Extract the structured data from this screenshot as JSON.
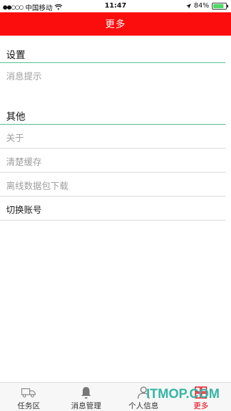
{
  "status_bar": {
    "carrier": "中国移动",
    "time": "11:47",
    "battery": "84%",
    "battery_level": 0.84,
    "signal_icon": "signal-dots-icon",
    "wifi_icon": "wifi-icon",
    "location_icon": "location-arrow-icon"
  },
  "nav": {
    "title": "更多",
    "color": "#fb0d0d"
  },
  "sections": {
    "settings": {
      "title": "设置",
      "items": [
        {
          "label": "消息提示"
        }
      ]
    },
    "other": {
      "title": "其他",
      "items": [
        {
          "label": "关于"
        },
        {
          "label": "清楚缓存"
        },
        {
          "label": "离线数据包下载"
        },
        {
          "label": "切换账号"
        }
      ]
    }
  },
  "tabs": [
    {
      "label": "任务区",
      "icon": "truck-icon",
      "active": false
    },
    {
      "label": "消息管理",
      "icon": "bell-icon",
      "active": false
    },
    {
      "label": "个人信息",
      "icon": "person-icon",
      "active": false
    },
    {
      "label": "更多",
      "icon": "grid-icon",
      "active": true
    }
  ],
  "colors": {
    "accent_red": "#fb0d0d",
    "divider_green": "#4cbf8a",
    "active_tab": "#e60012"
  },
  "watermark": "ITMOP.COM"
}
